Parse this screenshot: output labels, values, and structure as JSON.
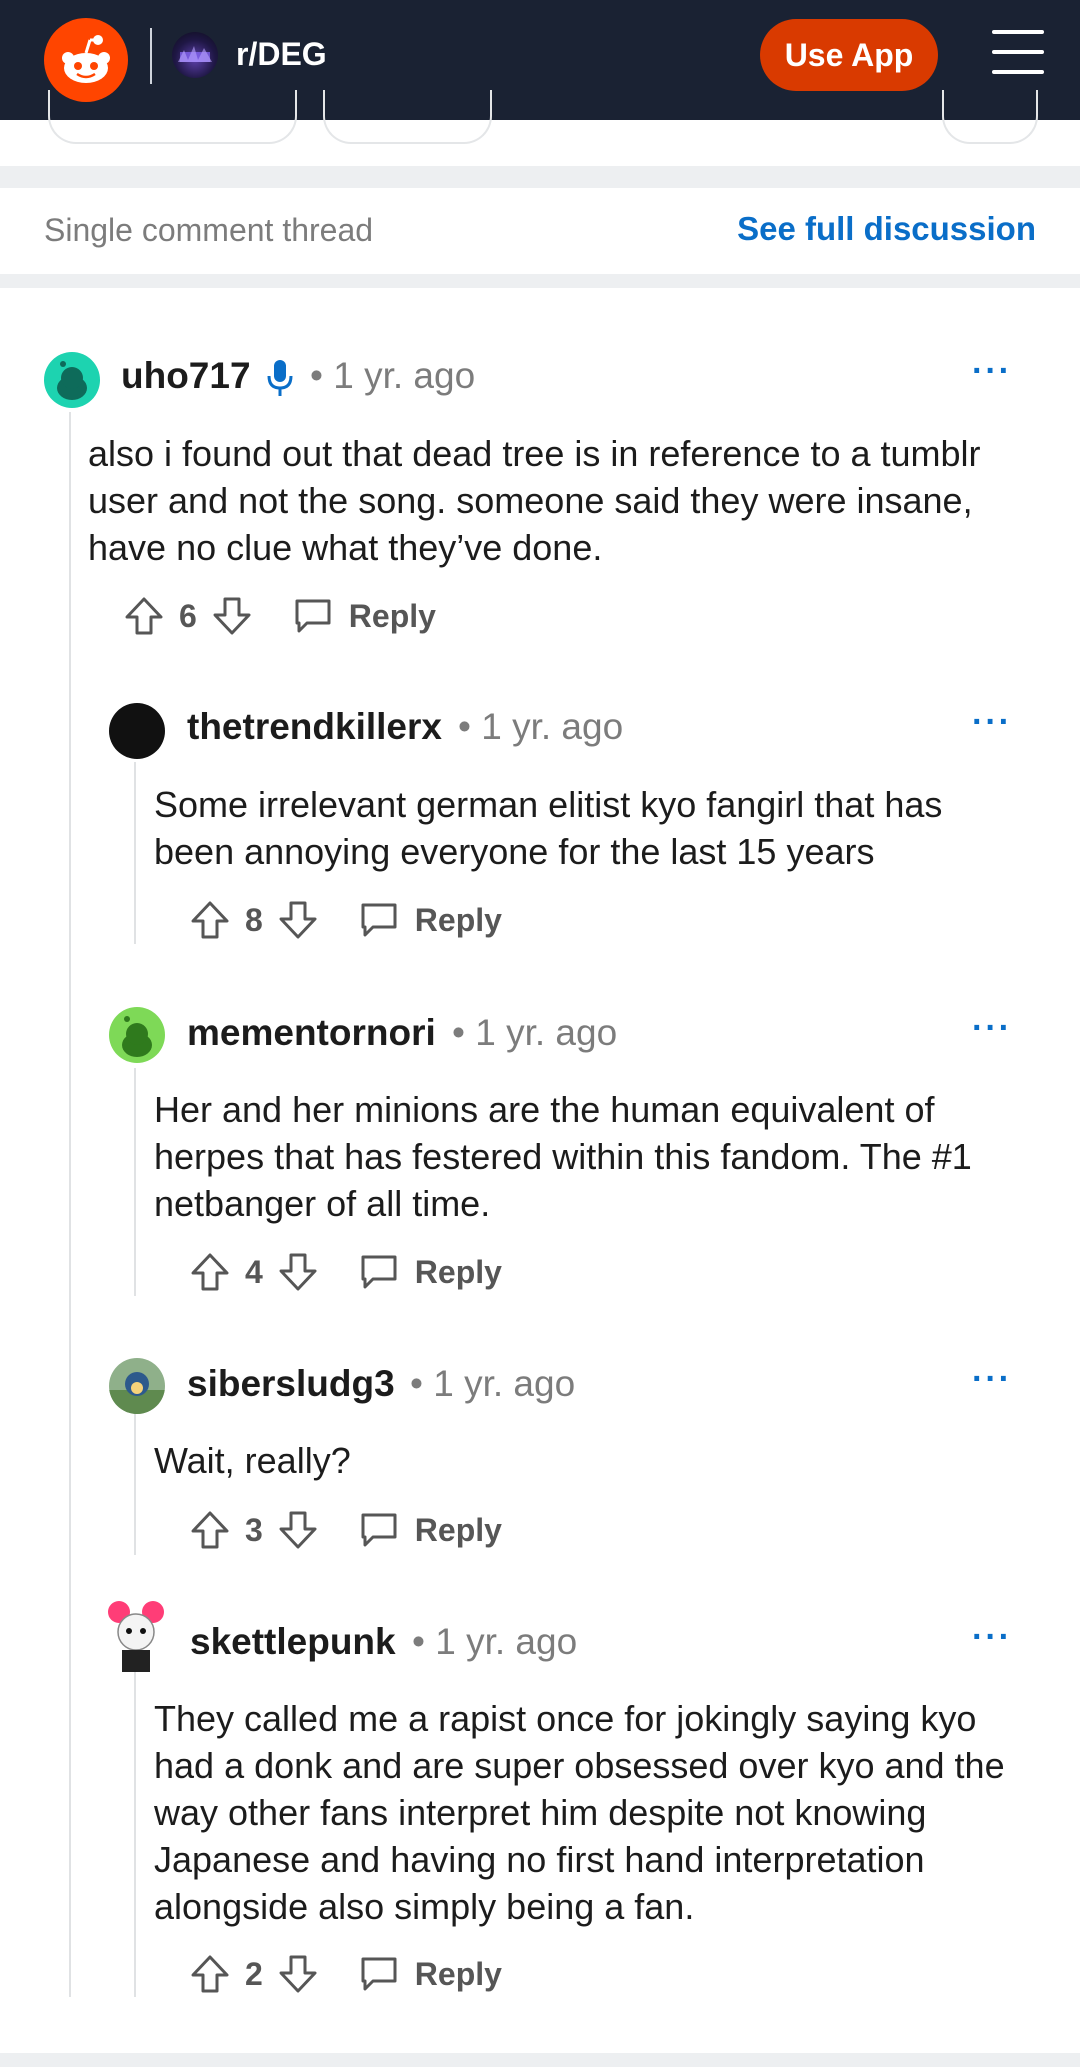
{
  "header": {
    "subreddit": "r/DEG",
    "use_app_label": "Use App",
    "brand_color": "#ff4500",
    "bg_color": "#1a2233"
  },
  "thread": {
    "label": "Single comment thread",
    "see_full_label": "See full discussion"
  },
  "comments": [
    {
      "username": "uho717",
      "has_mic_badge": true,
      "time": "1 yr. ago",
      "body": "also i found out that dead tree is in reference to a tumblr user and not the song. someone said they were insane, have no clue what they’ve done.",
      "score": "6",
      "reply_label": "Reply",
      "avatar_color": "#1dd3b0"
    },
    {
      "username": "thetrendkillerx",
      "time": "1 yr. ago",
      "body": "Some irrelevant german elitist kyo fangirl that has been annoying everyone for the last 15 years",
      "score": "8",
      "reply_label": "Reply",
      "avatar_color": "#111111"
    },
    {
      "username": "mementornori",
      "time": "1 yr. ago",
      "body": "Her and her minions are the human equivalent of herpes that has festered within this fandom. The #1 netbanger of all time.",
      "score": "4",
      "reply_label": "Reply",
      "avatar_color": "#7ed957"
    },
    {
      "username": "sibersludg3",
      "time": "1 yr. ago",
      "body": "Wait, really?",
      "score": "3",
      "reply_label": "Reply",
      "avatar_color": "#8fb08a"
    },
    {
      "username": "skettlepunk",
      "time": "1 yr. ago",
      "body": "They called me a rapist once for jokingly saying kyo had a donk and are super obsessed over kyo and the way other fans interpret him despite not knowing Japanese and having no first hand interpretation alongside also simply being a fan.",
      "score": "2",
      "reply_label": "Reply",
      "avatar_color": "#ff3d77"
    }
  ],
  "more_label": "···",
  "icons": {
    "upvote": "arrow-up-outline",
    "downvote": "arrow-down-outline",
    "reply": "speech-bubble-outline",
    "more": "ellipsis",
    "menu": "hamburger",
    "mic": "microphone"
  }
}
